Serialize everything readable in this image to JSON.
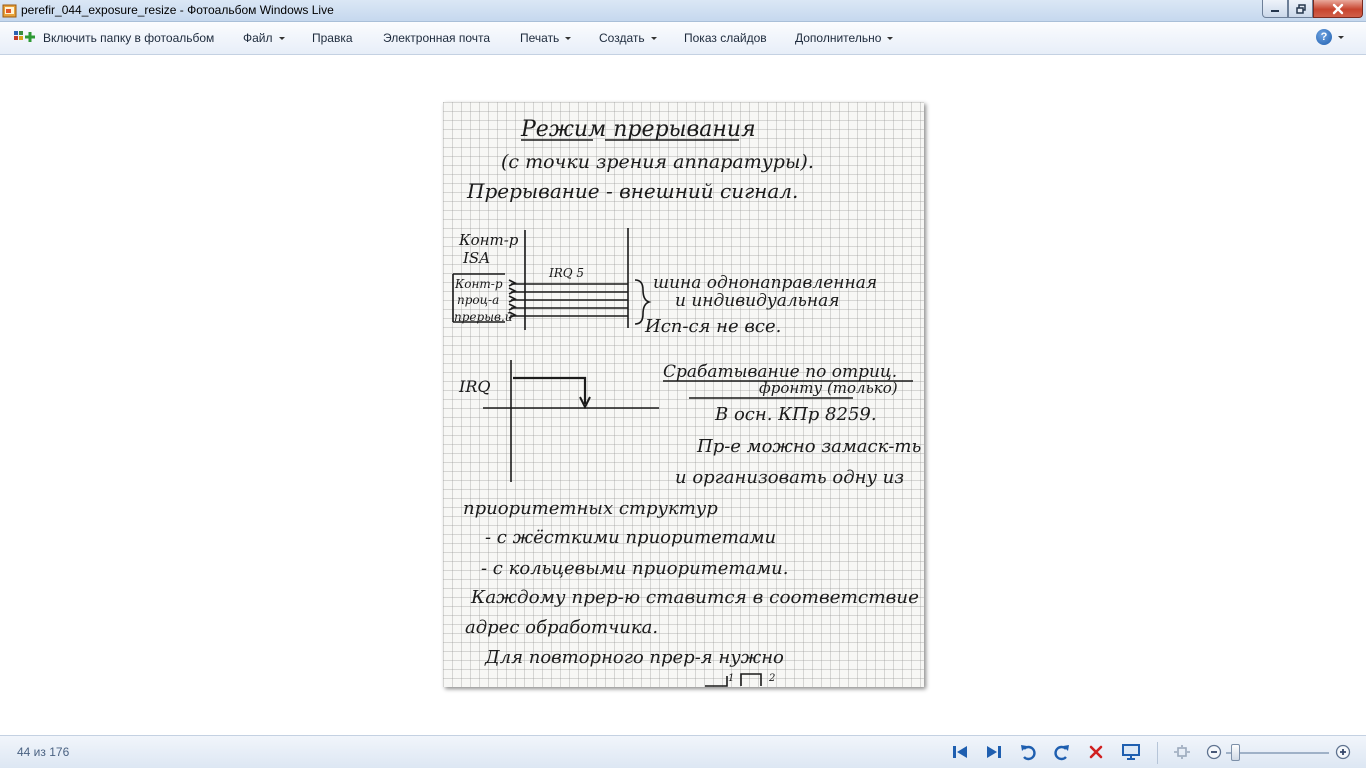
{
  "window": {
    "title": "perefir_044_exposure_resize - Фотоальбом Windows Live"
  },
  "menu": {
    "include_folder": "Включить папку в фотоальбом",
    "file": "Файл",
    "edit": "Правка",
    "email": "Электронная почта",
    "print": "Печать",
    "create": "Создать",
    "slideshow": "Показ слайдов",
    "more": "Дополнительно"
  },
  "photo": {
    "lines": [
      "Режим прерывания",
      "(с точки зрения аппаратуры).",
      "Прерывание - внешний сигнал.",
      "Конт-р",
      "ISA",
      "IRQ 5",
      "Конт-р",
      "проц-а",
      "прерыв.й",
      "шина однонаправленная",
      "и индивидуальная",
      "Исп-ся не все.",
      "IRQ",
      "Срабатывание по отриц.",
      "фронту (только)",
      "В осн. КПр 8259.",
      "Пр-е можно замаск-ть",
      "и организовать одну из",
      "приоритетных структур",
      "- с жёсткими приоритетами",
      "- с кольцевыми приоритетами.",
      "Каждому прер-ю ставится в соответствие",
      "адрес обработчика.",
      "Для повторного прер-я нужно",
      "1",
      "2"
    ]
  },
  "status": {
    "counter": "44 из 176"
  },
  "controls": {
    "zoom_level": 0.05
  },
  "colors": {
    "accent": "#1f5fb0",
    "ink": "#1a1a1a",
    "delete": "#d02020"
  },
  "icons": [
    "app-photo-icon",
    "minimize-icon",
    "maximize-icon",
    "close-icon",
    "include-folder-icon",
    "help-icon",
    "previous-icon",
    "next-icon",
    "rotate-left-icon",
    "rotate-right-icon",
    "delete-icon",
    "slideshow-icon",
    "actual-size-icon",
    "zoom-out-icon",
    "zoom-in-icon"
  ]
}
